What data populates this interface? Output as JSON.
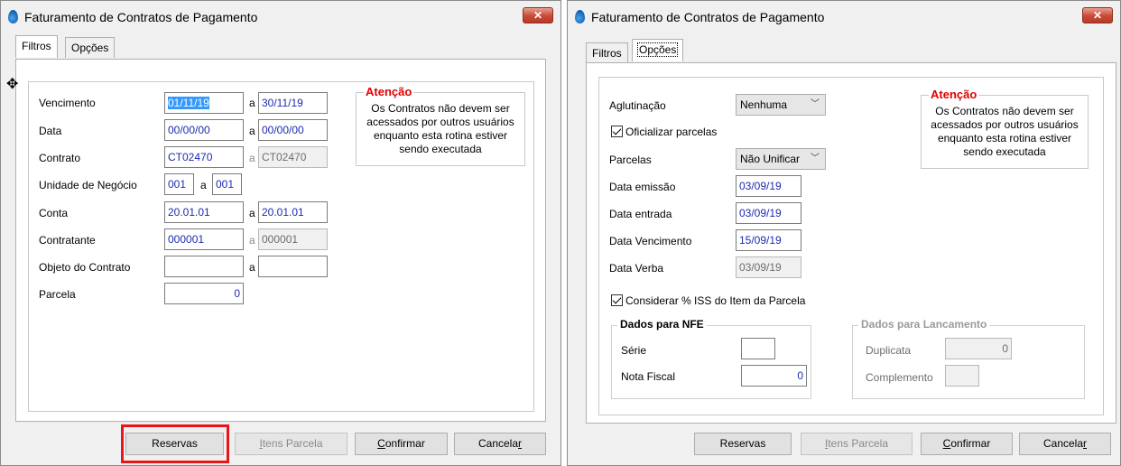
{
  "colors": {
    "accent_red": "#e8161c",
    "input_text": "#1c2cb0",
    "warning_title": "#e00000"
  },
  "left_window": {
    "title": "Faturamento de Contratos de Pagamento",
    "tabs": [
      "Filtros",
      "Opções"
    ],
    "active_tab": "Filtros",
    "fields": {
      "vencimento": {
        "label": "Vencimento",
        "from": "01/11/19",
        "sep": "a",
        "to": "30/11/19"
      },
      "data": {
        "label": "Data",
        "from": "00/00/00",
        "sep": "a",
        "to": "00/00/00"
      },
      "contrato": {
        "label": "Contrato",
        "from": "CT02470",
        "sep": "a",
        "to": "CT02470"
      },
      "unidade": {
        "label": "Unidade de Negócio",
        "from": "001",
        "sep": "a",
        "to": "001"
      },
      "conta": {
        "label": "Conta",
        "from": "20.01.01",
        "sep": "a",
        "to": "20.01.01"
      },
      "contratante": {
        "label": "Contratante",
        "from": "000001",
        "sep": "a",
        "to": "000001"
      },
      "objeto": {
        "label": "Objeto do Contrato",
        "from": "",
        "sep": "a",
        "to": ""
      },
      "parcela": {
        "label": "Parcela",
        "value": "0"
      }
    },
    "alert": {
      "title": "Atenção",
      "text": "Os Contratos não devem ser acessados por outros usuários enquanto esta rotina estiver sendo executada"
    },
    "buttons": {
      "reservas": "Reservas",
      "itens_parcela": {
        "pre": "",
        "ul": "I",
        "post": "tens Parcela"
      },
      "confirmar": {
        "pre": "",
        "ul": "C",
        "post": "onfirmar"
      },
      "cancelar": {
        "pre": "Cancela",
        "ul": "r",
        "post": ""
      }
    }
  },
  "right_window": {
    "title": "Faturamento de Contratos de Pagamento",
    "tabs": [
      "Filtros",
      "Opções"
    ],
    "active_tab": "Opções",
    "aglutinacao": {
      "label": "Aglutinação",
      "value": "Nenhuma"
    },
    "oficializar": {
      "label": "Oficializar parcelas",
      "checked": true
    },
    "parcelas": {
      "label": "Parcelas",
      "value": "Não Unificar"
    },
    "data_emissao": {
      "label": "Data emissão",
      "value": "03/09/19"
    },
    "data_entrada": {
      "label": "Data entrada",
      "value": "03/09/19"
    },
    "data_vencimento": {
      "label": "Data Vencimento",
      "value": "15/09/19"
    },
    "data_verba": {
      "label": "Data Verba",
      "value": "03/09/19"
    },
    "considerar_iss": {
      "label": "Considerar % ISS do Item da Parcela",
      "checked": true
    },
    "nfe_group": {
      "title": "Dados para NFE",
      "serie_label": "Série",
      "serie_value": "",
      "nota_label": "Nota Fiscal",
      "nota_value": "0"
    },
    "lanc_group": {
      "title": "Dados para Lancamento",
      "duplicata_label": "Duplicata",
      "duplicata_value": "0",
      "complemento_label": "Complemento",
      "complemento_value": ""
    },
    "alert": {
      "title": "Atenção",
      "text": "Os Contratos não devem ser acessados por outros usuários enquanto esta rotina estiver sendo executada"
    },
    "buttons": {
      "reservas": "Reservas",
      "itens_parcela": {
        "pre": "",
        "ul": "I",
        "post": "tens Parcela"
      },
      "confirmar": {
        "pre": "",
        "ul": "C",
        "post": "onfirmar"
      },
      "cancelar": {
        "pre": "Cancela",
        "ul": "r",
        "post": ""
      }
    }
  }
}
